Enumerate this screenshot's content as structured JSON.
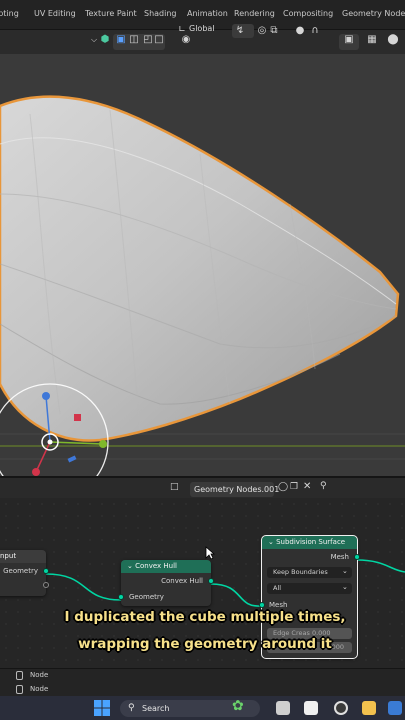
{
  "workspace_tabs": [
    "lpting",
    "UV Editing",
    "Texture Paint",
    "Shading",
    "Animation",
    "Rendering",
    "Compositing",
    "Geometry Nodes"
  ],
  "viewport_header": {
    "orientation": "Global",
    "icons": [
      "chevron-down-icon",
      "viewport-gizmo-icon",
      "select-box-icon",
      "edit-mode-icon",
      "transform-orientation-icon",
      "snap-icon",
      "proportional-edit-icon",
      "falloff-icon",
      "overlays-icon",
      "shading-icon",
      "xray-icon"
    ]
  },
  "node_editor_header": {
    "node_group_name": "Geometry Nodes.001"
  },
  "nodes": {
    "group_input": {
      "title": "nput",
      "outputs": [
        "Geometry"
      ]
    },
    "convex_hull": {
      "title": "Convex Hull",
      "outputs": [
        "Convex Hull"
      ],
      "inputs": [
        "Geometry"
      ]
    },
    "subdivision_surface": {
      "title": "Subdivision Surface",
      "outputs": [
        "Mesh"
      ],
      "boundary": "Keep Boundaries",
      "uv_smooth": "All",
      "inputs": [
        "Mesh"
      ],
      "edge_crease_label": "Edge Creas",
      "edge_crease_value": "0.000",
      "vertex_value": "0.000"
    }
  },
  "subtitle": {
    "line1": "I duplicated the cube multiple times,",
    "line2": "wrapping the geometry around it"
  },
  "outliner": [
    "Node",
    "Node"
  ],
  "taskbar": {
    "search_label": "Search"
  },
  "colors": {
    "node_header": "#1f6f57",
    "geometry_socket": "#00d6a3",
    "selection_outline": "#e8963a",
    "subtitle": "#f6e08a"
  }
}
